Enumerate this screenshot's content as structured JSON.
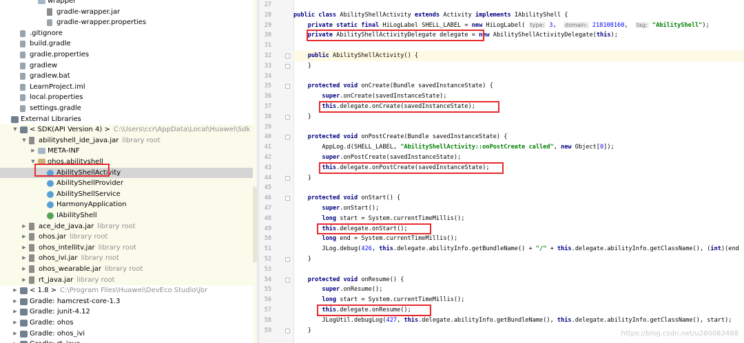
{
  "project_tree": {
    "rows": [
      {
        "label": "wrapper",
        "depth": 3,
        "icon": "folder-icon",
        "arrow": "",
        "hl": false
      },
      {
        "label": "gradle-wrapper.jar",
        "depth": 4,
        "icon": "jar-file-icon",
        "arrow": "",
        "hl": false
      },
      {
        "label": "gradle-wrapper.properties",
        "depth": 4,
        "icon": "file-icon",
        "arrow": "",
        "hl": false
      },
      {
        "label": ".gitignore",
        "depth": 1,
        "icon": "file-icon",
        "arrow": "",
        "hl": false
      },
      {
        "label": "build.gradle",
        "depth": 1,
        "icon": "gradle-icon",
        "arrow": "",
        "hl": false
      },
      {
        "label": "gradle.properties",
        "depth": 1,
        "icon": "file-icon",
        "arrow": "",
        "hl": false
      },
      {
        "label": "gradlew",
        "depth": 1,
        "icon": "file-icon",
        "arrow": "",
        "hl": false
      },
      {
        "label": "gradlew.bat",
        "depth": 1,
        "icon": "file-icon",
        "arrow": "",
        "hl": false
      },
      {
        "label": "LearnProject.iml",
        "depth": 1,
        "icon": "file-icon",
        "arrow": "",
        "hl": false
      },
      {
        "label": "local.properties",
        "depth": 1,
        "icon": "file-icon",
        "arrow": "",
        "hl": false
      },
      {
        "label": "settings.gradle",
        "depth": 1,
        "icon": "gradle-icon",
        "arrow": "",
        "hl": false
      },
      {
        "label": "External Libraries",
        "depth": 0,
        "icon": "library-icon",
        "arrow": "",
        "hl": false
      },
      {
        "label": "< SDK(API Version 4) >",
        "sub": "C:\\Users\\ccr\\AppData\\Local\\Huawei\\Sdk",
        "depth": 1,
        "icon": "sdk-icon",
        "arrow": "▼",
        "hl": true
      },
      {
        "label": "abilityshell_ide_java.jar",
        "sub": "library root",
        "depth": 2,
        "icon": "jar-file-icon",
        "arrow": "▼",
        "hl": true
      },
      {
        "label": "META-INF",
        "depth": 3,
        "icon": "folder-icon",
        "arrow": "▶",
        "hl": true
      },
      {
        "label": "ohos.abilityshell",
        "depth": 3,
        "icon": "package-icon",
        "arrow": "▼",
        "hl": true
      },
      {
        "label": "AbilityShellActivity",
        "depth": 4,
        "icon": "class-icon",
        "arrow": "",
        "hl": false,
        "sel": true
      },
      {
        "label": "AbilityShellProvider",
        "depth": 4,
        "icon": "class-icon",
        "arrow": "",
        "hl": true
      },
      {
        "label": "AbilityShellService",
        "depth": 4,
        "icon": "class-icon",
        "arrow": "",
        "hl": true
      },
      {
        "label": "HarmonyApplication",
        "depth": 4,
        "icon": "class-icon",
        "arrow": "",
        "hl": true
      },
      {
        "label": "IAbilityShell",
        "depth": 4,
        "icon": "interface-icon",
        "arrow": "",
        "hl": true
      },
      {
        "label": "ace_ide_java.jar",
        "sub": "library root",
        "depth": 2,
        "icon": "jar-file-icon",
        "arrow": "▶",
        "hl": true
      },
      {
        "label": "ohos.jar",
        "sub": "library root",
        "depth": 2,
        "icon": "jar-file-icon",
        "arrow": "▶",
        "hl": true
      },
      {
        "label": "ohos_intellitv.jar",
        "sub": "library root",
        "depth": 2,
        "icon": "jar-file-icon",
        "arrow": "▶",
        "hl": true
      },
      {
        "label": "ohos_ivi.jar",
        "sub": "library root",
        "depth": 2,
        "icon": "jar-file-icon",
        "arrow": "▶",
        "hl": true
      },
      {
        "label": "ohos_wearable.jar",
        "sub": "library root",
        "depth": 2,
        "icon": "jar-file-icon",
        "arrow": "▶",
        "hl": true
      },
      {
        "label": "rt_java.jar",
        "sub": "library root",
        "depth": 2,
        "icon": "jar-file-icon",
        "arrow": "▶",
        "hl": true
      },
      {
        "label": "< 1.8 >",
        "sub": "C:\\Program Files\\Huawei\\DevEco Studio\\jbr",
        "depth": 1,
        "icon": "sdk-icon",
        "arrow": "▶",
        "hl": false
      },
      {
        "label": "Gradle: hamcrest-core-1.3",
        "depth": 1,
        "icon": "library-icon",
        "arrow": "▶",
        "hl": false
      },
      {
        "label": "Gradle: junit-4.12",
        "depth": 1,
        "icon": "library-icon",
        "arrow": "▶",
        "hl": false
      },
      {
        "label": "Gradle: ohos",
        "depth": 1,
        "icon": "library-icon",
        "arrow": "▶",
        "hl": false
      },
      {
        "label": "Gradle: ohos_ivi",
        "depth": 1,
        "icon": "library-icon",
        "arrow": "▶",
        "hl": false
      },
      {
        "label": "Gradle: rt_java",
        "depth": 1,
        "icon": "library-icon",
        "arrow": "▶",
        "hl": false
      }
    ]
  },
  "editor": {
    "current_line": 32,
    "lines": [
      {
        "n": 27,
        "segs": []
      },
      {
        "n": 28,
        "segs": [
          [
            "kw",
            "public class "
          ],
          [
            "",
            "AbilityShellActivity "
          ],
          [
            "kw",
            "extends "
          ],
          [
            "",
            "Activity "
          ],
          [
            "kw",
            "implements "
          ],
          [
            "",
            "IAbilityShell {"
          ]
        ]
      },
      {
        "n": 29,
        "segs": [
          [
            "",
            "    "
          ],
          [
            "kw",
            "private static final "
          ],
          [
            "",
            "HiLogLabel SHELL_LABEL = "
          ],
          [
            "kw",
            "new "
          ],
          [
            "",
            "HiLogLabel( "
          ],
          [
            "hint",
            "type:"
          ],
          [
            "num",
            " 3"
          ],
          [
            "",
            ",  "
          ],
          [
            "hint",
            "domain:"
          ],
          [
            "num",
            " 218108160"
          ],
          [
            "",
            ",  "
          ],
          [
            "hint",
            "tag:"
          ],
          [
            "str",
            " \"AbilityShell\""
          ],
          [
            "",
            ");"
          ]
        ]
      },
      {
        "n": 30,
        "segs": [
          [
            "",
            "    "
          ],
          [
            "kw",
            "private "
          ],
          [
            "",
            "AbilityShellActivityDelegate delegate = "
          ],
          [
            "kw",
            "new "
          ],
          [
            "",
            "AbilityShellActivityDelegate("
          ],
          [
            "kw",
            "this"
          ],
          [
            "",
            ");"
          ]
        ]
      },
      {
        "n": 31,
        "segs": []
      },
      {
        "n": 32,
        "segs": [
          [
            "",
            "    "
          ],
          [
            "kw",
            "public "
          ],
          [
            "",
            "AbilityShellActivity() {"
          ]
        ]
      },
      {
        "n": 33,
        "segs": [
          [
            "",
            "    }"
          ]
        ]
      },
      {
        "n": 34,
        "segs": []
      },
      {
        "n": 35,
        "segs": [
          [
            "",
            "    "
          ],
          [
            "kw",
            "protected void "
          ],
          [
            "",
            "onCreate(Bundle savedInstanceState) {"
          ]
        ]
      },
      {
        "n": 36,
        "segs": [
          [
            "",
            "        "
          ],
          [
            "kw",
            "super"
          ],
          [
            "",
            ".onCreate(savedInstanceState);"
          ]
        ]
      },
      {
        "n": 37,
        "segs": [
          [
            "",
            "        "
          ],
          [
            "kw",
            "this"
          ],
          [
            "",
            ".delegate.onCreate(savedInstanceState);"
          ]
        ]
      },
      {
        "n": 38,
        "segs": [
          [
            "",
            "    }"
          ]
        ]
      },
      {
        "n": 39,
        "segs": []
      },
      {
        "n": 40,
        "segs": [
          [
            "",
            "    "
          ],
          [
            "kw",
            "protected void "
          ],
          [
            "",
            "onPostCreate(Bundle savedInstanceState) {"
          ]
        ]
      },
      {
        "n": 41,
        "segs": [
          [
            "",
            "        AppLog.d(SHELL_LABEL, "
          ],
          [
            "str",
            "\"AbilityShellActivity::onPostCreate called\""
          ],
          [
            "",
            ", "
          ],
          [
            "kw",
            "new "
          ],
          [
            "",
            "Object["
          ],
          [
            "num",
            "0"
          ],
          [
            "",
            "]);"
          ]
        ]
      },
      {
        "n": 42,
        "segs": [
          [
            "",
            "        "
          ],
          [
            "kw",
            "super"
          ],
          [
            "",
            ".onPostCreate(savedInstanceState);"
          ]
        ]
      },
      {
        "n": 43,
        "segs": [
          [
            "",
            "        "
          ],
          [
            "kw",
            "this"
          ],
          [
            "",
            ".delegate.onPostCreate(savedInstanceState);"
          ]
        ]
      },
      {
        "n": 44,
        "segs": [
          [
            "",
            "    }"
          ]
        ]
      },
      {
        "n": 45,
        "segs": []
      },
      {
        "n": 46,
        "segs": [
          [
            "",
            "    "
          ],
          [
            "kw",
            "protected void "
          ],
          [
            "",
            "onStart() {"
          ]
        ]
      },
      {
        "n": 47,
        "segs": [
          [
            "",
            "        "
          ],
          [
            "kw",
            "super"
          ],
          [
            "",
            ".onStart();"
          ]
        ]
      },
      {
        "n": 48,
        "segs": [
          [
            "",
            "        "
          ],
          [
            "kw",
            "long "
          ],
          [
            "",
            "start = System."
          ],
          [
            "",
            "currentTimeMillis();"
          ]
        ]
      },
      {
        "n": 49,
        "segs": [
          [
            "",
            "        "
          ],
          [
            "kw",
            "this"
          ],
          [
            "",
            ".delegate.onStart();"
          ]
        ]
      },
      {
        "n": 50,
        "segs": [
          [
            "",
            "        "
          ],
          [
            "kw",
            "long "
          ],
          [
            "",
            "end = System.currentTimeMillis();"
          ]
        ]
      },
      {
        "n": 51,
        "segs": [
          [
            "",
            "        JLog.debug("
          ],
          [
            "num",
            "426"
          ],
          [
            "",
            ", "
          ],
          [
            "kw",
            "this"
          ],
          [
            "",
            ".delegate.abilityInfo.getBundleName() + "
          ],
          [
            "str",
            "\"/\""
          ],
          [
            "",
            " + "
          ],
          [
            "kw",
            "this"
          ],
          [
            "",
            ".delegate.abilityInfo.getClassName(), ("
          ],
          [
            "kw",
            "int"
          ],
          [
            "",
            ")(end"
          ]
        ]
      },
      {
        "n": 52,
        "segs": [
          [
            "",
            "    }"
          ]
        ]
      },
      {
        "n": 53,
        "segs": []
      },
      {
        "n": 54,
        "segs": [
          [
            "",
            "    "
          ],
          [
            "kw",
            "protected void "
          ],
          [
            "",
            "onResume() {"
          ]
        ]
      },
      {
        "n": 55,
        "segs": [
          [
            "",
            "        "
          ],
          [
            "kw",
            "super"
          ],
          [
            "",
            ".onResume();"
          ]
        ]
      },
      {
        "n": 56,
        "segs": [
          [
            "",
            "        "
          ],
          [
            "kw",
            "long "
          ],
          [
            "",
            "start = System.currentTimeMillis();"
          ]
        ]
      },
      {
        "n": 57,
        "segs": [
          [
            "",
            "        "
          ],
          [
            "kw",
            "this"
          ],
          [
            "",
            ".delegate.onResume();"
          ]
        ]
      },
      {
        "n": 58,
        "segs": [
          [
            "",
            "        JLogUtil.debugLog("
          ],
          [
            "num",
            "427"
          ],
          [
            "",
            ", "
          ],
          [
            "kw",
            "this"
          ],
          [
            "",
            ".delegate.abilityInfo.getBundleName(), "
          ],
          [
            "kw",
            "this"
          ],
          [
            "",
            ".delegate.abilityInfo.getClassName(), start);"
          ]
        ]
      },
      {
        "n": 59,
        "segs": [
          [
            "",
            "    }"
          ]
        ]
      }
    ]
  },
  "watermark": "https://blog.csdn.net/u280083468",
  "colors": {
    "highlight_box": "#e8282c",
    "keyword": "#000080",
    "string": "#008000",
    "number": "#0000ff"
  }
}
